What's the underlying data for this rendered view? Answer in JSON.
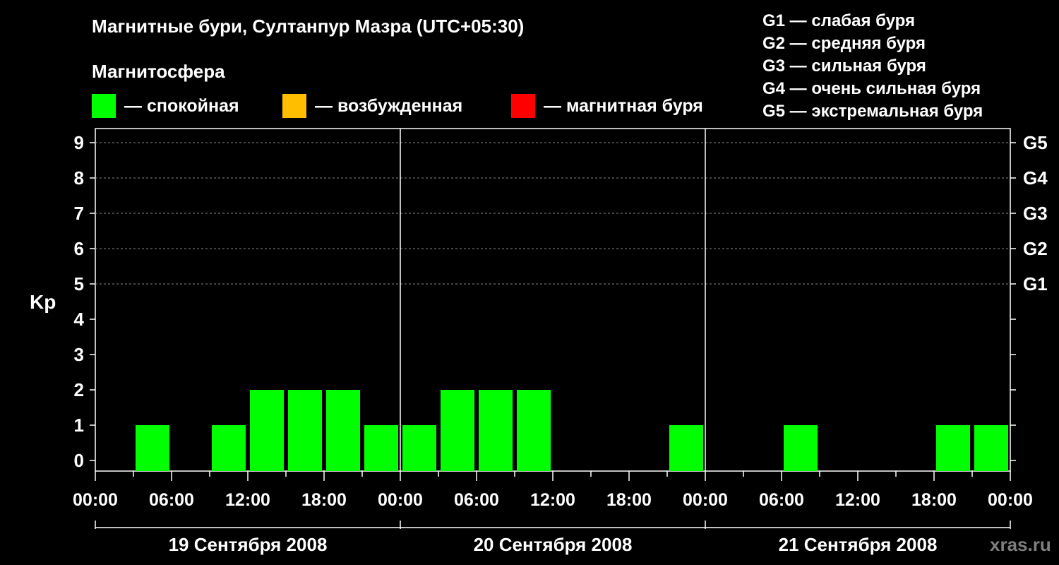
{
  "title": "Магнитные бури, Султанпур Мазра (UTC+05:30)",
  "magnetosphere_label": "Магнитосфера",
  "legend": [
    {
      "label": "— спокойная",
      "color": "#00ff00"
    },
    {
      "label": "— возбужденная",
      "color": "#ffbf00"
    },
    {
      "label": "— магнитная буря",
      "color": "#ff0000"
    }
  ],
  "storm_scale": [
    "G1 — слабая буря",
    "G2 — средняя буря",
    "G3 — сильная буря",
    "G4 — очень сильная буря",
    "G5 — экстремальная буря"
  ],
  "watermark": "xras.ru",
  "chart_data": {
    "type": "bar",
    "ylabel": "Kp",
    "ylim": [
      0,
      9
    ],
    "yticks": [
      "0",
      "1",
      "2",
      "3",
      "4",
      "5",
      "6",
      "7",
      "8",
      "9"
    ],
    "right_ticks": [
      {
        "kp": 5,
        "label": "G1"
      },
      {
        "kp": 6,
        "label": "G2"
      },
      {
        "kp": 7,
        "label": "G3"
      },
      {
        "kp": 8,
        "label": "G4"
      },
      {
        "kp": 9,
        "label": "G5"
      }
    ],
    "grid": "dashed horizontal at Kp 5–9",
    "xticks": [
      "00:00",
      "06:00",
      "12:00",
      "18:00",
      "00:00",
      "06:00",
      "12:00",
      "18:00",
      "00:00",
      "06:00",
      "12:00",
      "18:00",
      "00:00"
    ],
    "days": [
      "19 Сентября 2008",
      "20 Сентября 2008",
      "21 Сентября 2008"
    ],
    "interval_hours": 3,
    "values": [
      0,
      1,
      0,
      1,
      2,
      2,
      2,
      1,
      1,
      2,
      2,
      2,
      0,
      0,
      0,
      1,
      0,
      0,
      1,
      0,
      0,
      0,
      1,
      1
    ]
  }
}
